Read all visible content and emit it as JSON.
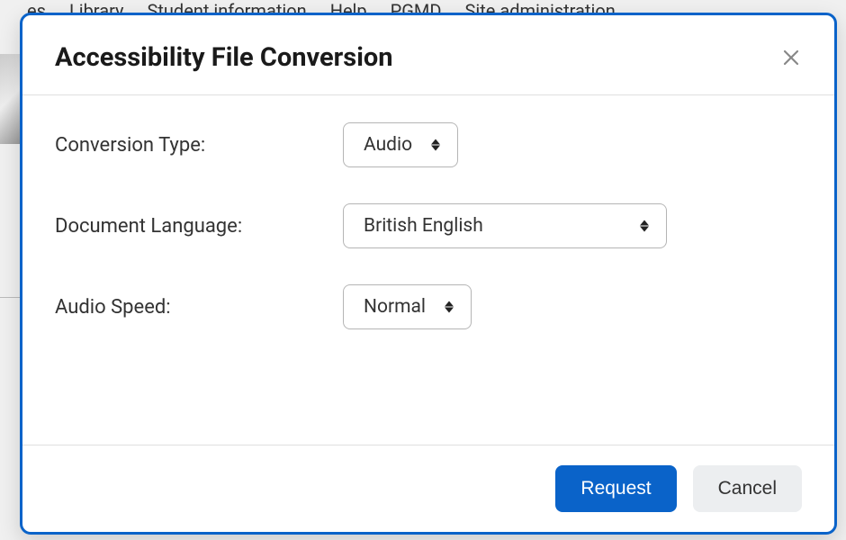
{
  "bg_nav": {
    "item0": "es",
    "item1": "Library",
    "item2": "Student information",
    "item3": "Help",
    "item4": "PGMD",
    "item5": "Site administration"
  },
  "dialog": {
    "title": "Accessibility File Conversion",
    "close_icon": "close-icon",
    "labels": {
      "conversion_type": "Conversion Type:",
      "document_language": "Document Language:",
      "audio_speed": "Audio Speed:"
    },
    "values": {
      "conversion_type": "Audio",
      "document_language": "British English",
      "audio_speed": "Normal"
    },
    "buttons": {
      "request": "Request",
      "cancel": "Cancel"
    }
  }
}
